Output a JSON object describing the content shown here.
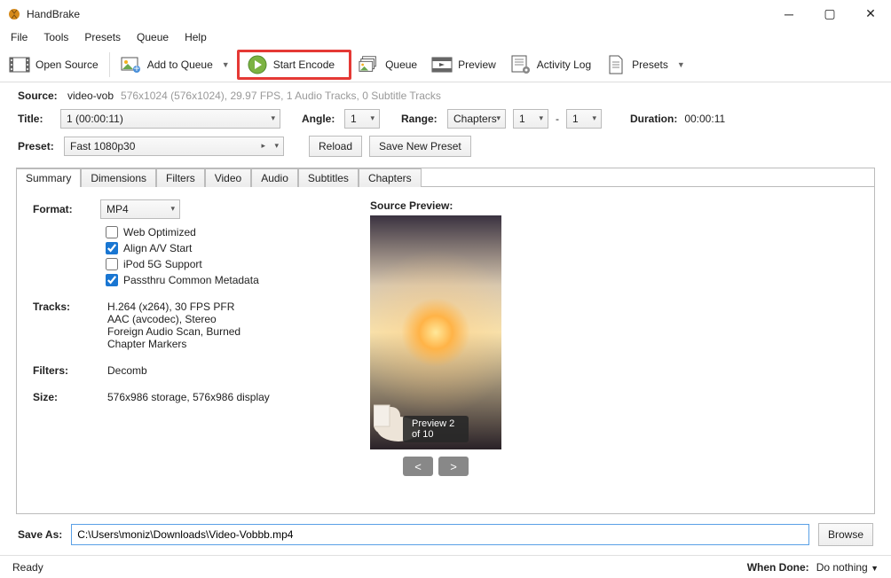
{
  "window": {
    "title": "HandBrake"
  },
  "menu": [
    "File",
    "Tools",
    "Presets",
    "Queue",
    "Help"
  ],
  "toolbar": {
    "open_source": "Open Source",
    "add_to_queue": "Add to Queue",
    "start_encode": "Start Encode",
    "queue": "Queue",
    "preview": "Preview",
    "activity_log": "Activity Log",
    "presets": "Presets"
  },
  "source": {
    "label": "Source:",
    "name": "video-vob",
    "details": "576x1024 (576x1024), 29.97 FPS, 1 Audio Tracks, 0 Subtitle Tracks"
  },
  "titleRow": {
    "label": "Title:",
    "value": "1  (00:00:11)",
    "angle_label": "Angle:",
    "angle": "1",
    "range_label": "Range:",
    "range_mode": "Chapters",
    "range_from": "1",
    "range_dash": "-",
    "range_to": "1",
    "duration_label": "Duration:",
    "duration": "00:00:11"
  },
  "presetRow": {
    "label": "Preset:",
    "value": "Fast 1080p30",
    "reload": "Reload",
    "save_new": "Save New Preset"
  },
  "tabs": [
    "Summary",
    "Dimensions",
    "Filters",
    "Video",
    "Audio",
    "Subtitles",
    "Chapters"
  ],
  "summary": {
    "format_label": "Format:",
    "format_value": "MP4",
    "checks": {
      "web_opt": "Web Optimized",
      "align_av": "Align A/V Start",
      "ipod": "iPod 5G Support",
      "passthru": "Passthru Common Metadata"
    },
    "tracks_label": "Tracks:",
    "tracks": [
      "H.264 (x264), 30 FPS PFR",
      "AAC (avcodec), Stereo",
      "Foreign Audio Scan, Burned",
      "Chapter Markers"
    ],
    "filters_label": "Filters:",
    "filters": "Decomb",
    "size_label": "Size:",
    "size": "576x986 storage, 576x986 display",
    "preview_title": "Source Preview:",
    "preview_caption": "Preview 2 of 10"
  },
  "saveas": {
    "label": "Save As:",
    "path": "C:\\Users\\moniz\\Downloads\\Video-Vobbb.mp4",
    "browse": "Browse"
  },
  "statusbar": {
    "left": "Ready",
    "when_done_label": "When Done:",
    "when_done_value": "Do nothing"
  }
}
